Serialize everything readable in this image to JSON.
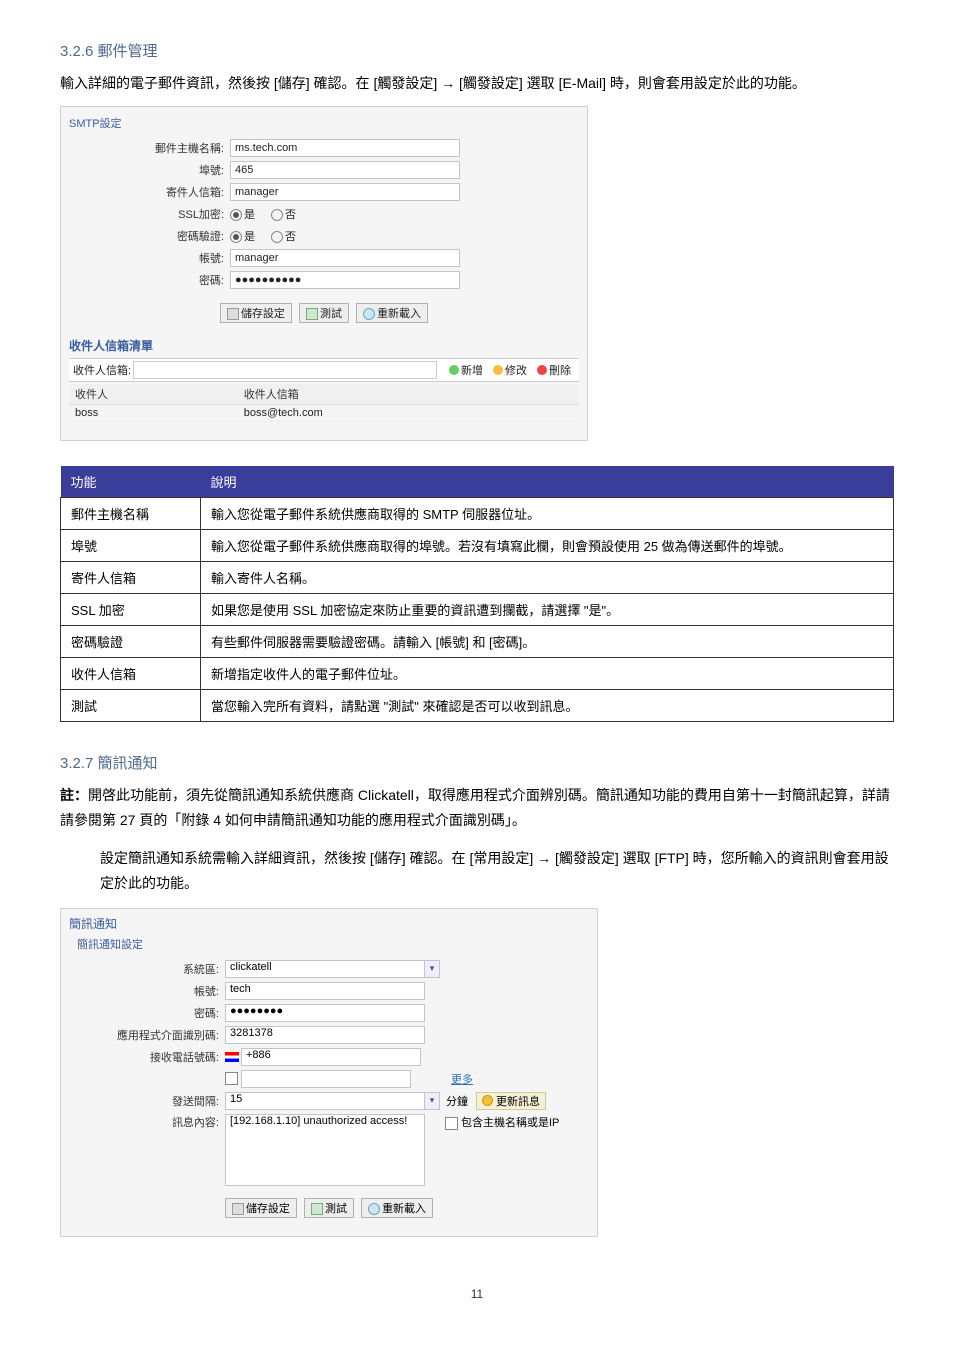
{
  "section326": {
    "heading": "3.2.6 郵件管理",
    "para": "輸入詳細的電子郵件資訊，然後按 [儲存] 確認。在 [觸發設定] → [觸發設定] 選取 [E-Mail] 時，則會套用設定於此的功能。"
  },
  "smtp_form": {
    "title": "SMTP設定",
    "rows": {
      "host_label": "郵件主機名稱:",
      "host_value": "ms.tech.com",
      "port_label": "埠號:",
      "port_value": "465",
      "sender_label": "寄件人信箱:",
      "sender_value": "manager",
      "ssl_label": "SSL加密:",
      "ssl_yes": "是",
      "ssl_no": "否",
      "auth_label": "密碼驗證:",
      "auth_yes": "是",
      "auth_no": "否",
      "acct_label": "帳號:",
      "acct_value": "manager",
      "pwd_label": "密碼:",
      "pwd_value": "●●●●●●●●●●"
    },
    "btn_save": "儲存設定",
    "btn_test": "測試",
    "btn_reload": "重新載入",
    "recipient_heading": "收件人信箱清單",
    "recipient_label": "收件人信箱:",
    "btn_add": "新增",
    "btn_edit": "修改",
    "btn_del": "刪除",
    "col_recipient": "收件人",
    "col_mail": "收件人信箱",
    "row_recipient": "boss",
    "row_mail": "boss@tech.com"
  },
  "desc_table": {
    "col_func": "功能",
    "col_desc": "說明",
    "rows": [
      {
        "f": "郵件主機名稱",
        "d": "輸入您從電子郵件系統供應商取得的 SMTP 伺服器位址。"
      },
      {
        "f": "埠號",
        "d": "輸入您從電子郵件系統供應商取得的埠號。若沒有填寫此欄，則會預設使用 25 做為傳送郵件的埠號。"
      },
      {
        "f": "寄件人信箱",
        "d": "輸入寄件人名稱。"
      },
      {
        "f": "SSL 加密",
        "d": "如果您是使用 SSL 加密協定來防止重要的資訊遭到攔截，請選擇 \"是\"。"
      },
      {
        "f": "密碼驗證",
        "d": "有些郵件伺服器需要驗證密碼。請輸入 [帳號] 和 [密碼]。"
      },
      {
        "f": "收件人信箱",
        "d": "新增指定收件人的電子郵件位址。"
      },
      {
        "f": "測試",
        "d": "當您輸入完所有資料，請點選 \"測試\" 來確認是否可以收到訊息。"
      }
    ]
  },
  "section327": {
    "heading": "3.2.7 簡訊通知",
    "note_label": "註：",
    "note": "開啓此功能前，須先從簡訊通知系統供應商 Clickatell，取得應用程式介面辨別碼。簡訊通知功能的費用自第十一封簡訊起算，詳請請參閱第 27 頁的「附錄 4  如何申請簡訊通知功能的應用程式介面識別碼」。",
    "para": "設定簡訊通知系統需輸入詳細資訊，然後按 [儲存] 確認。在 [常用設定] → [觸發設定] 選取 [FTP] 時，您所輸入的資訊則會套用設定於此的功能。"
  },
  "sms_form": {
    "title": "簡訊通知",
    "subtitle": "簡訊通知設定",
    "system_label": "系統區:",
    "system_value": "clickatell",
    "acct_label": "帳號:",
    "acct_value": "tech",
    "pwd_label": "密碼:",
    "pwd_value": "●●●●●●●●",
    "api_label": "應用程式介面識別碼:",
    "api_value": "3281378",
    "recvphone_label": "接收電話號碼:",
    "recvphone_prefix": "+886",
    "more_link": "更多",
    "interval_label": "發送間隔:",
    "interval_value": "15",
    "interval_unit": "分鐘",
    "interval_update": "更新訊息",
    "msg_label": "訊息內容:",
    "msg_value": "[192.168.1.10] unauthorized access!",
    "include_label": "包含主機名稱或是IP",
    "btn_save": "儲存設定",
    "btn_test": "測試",
    "btn_reload": "重新載入"
  },
  "page_number": "11"
}
